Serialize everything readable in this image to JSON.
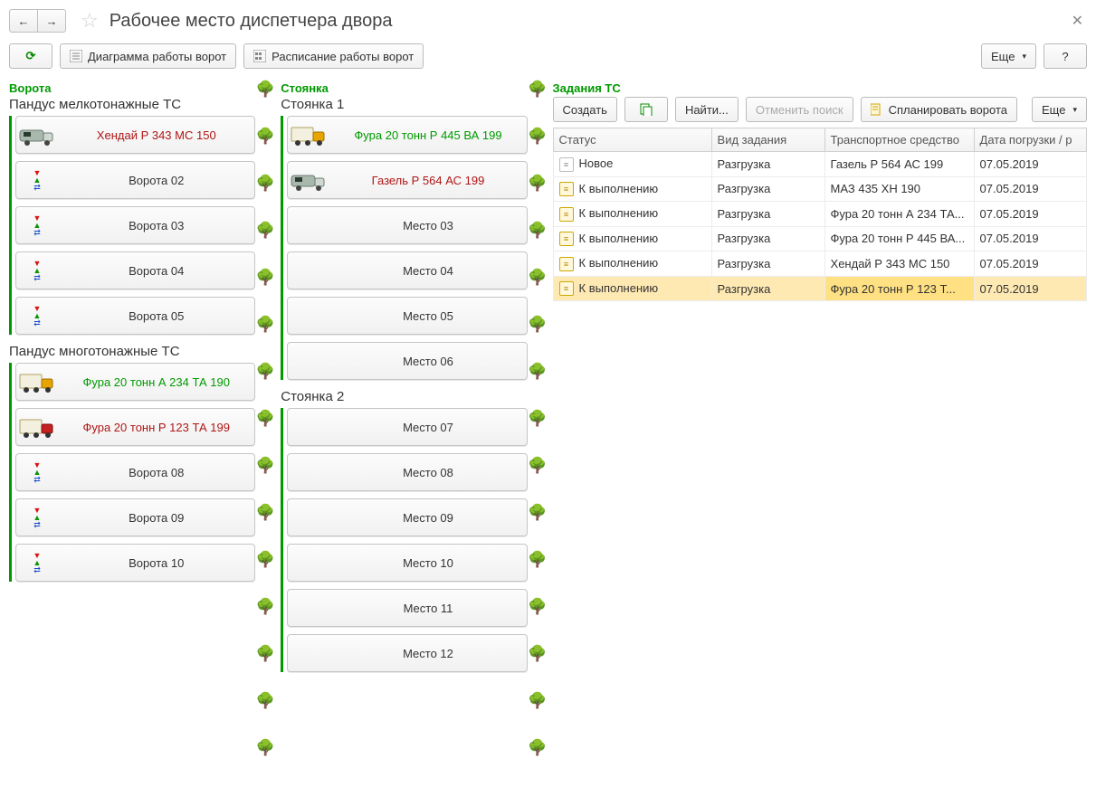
{
  "title": "Рабочее место диспетчера двора",
  "top_toolbar": {
    "refresh_tip": "⟳",
    "gate_diagram": "Диаграмма работы ворот",
    "gate_schedule": "Расписание работы ворот",
    "more": "Еще",
    "help": "?"
  },
  "gates_panel": {
    "title": "Ворота",
    "groups": [
      {
        "title": "Пандус мелкотонажные ТС",
        "slots": [
          {
            "name": "gate-01",
            "icon": "van-grey",
            "label": "Хендай Р 343 МС 150",
            "color": "red"
          },
          {
            "name": "gate-02",
            "icon": "arrows",
            "label": "Ворота 02",
            "color": ""
          },
          {
            "name": "gate-03",
            "icon": "arrows",
            "label": "Ворота 03",
            "color": ""
          },
          {
            "name": "gate-04",
            "icon": "arrows",
            "label": "Ворота 04",
            "color": ""
          },
          {
            "name": "gate-05",
            "icon": "arrows",
            "label": "Ворота 05",
            "color": ""
          }
        ]
      },
      {
        "title": "Пандус многотонажные ТС",
        "slots": [
          {
            "name": "gate-06",
            "icon": "truck-yellow",
            "label": "Фура 20 тонн А 234 ТА 190",
            "color": "green"
          },
          {
            "name": "gate-07",
            "icon": "truck-red",
            "label": "Фура 20 тонн  Р 123 ТА 199",
            "color": "red"
          },
          {
            "name": "gate-08",
            "icon": "arrows",
            "label": "Ворота 08",
            "color": ""
          },
          {
            "name": "gate-09",
            "icon": "arrows",
            "label": "Ворота 09",
            "color": ""
          },
          {
            "name": "gate-10",
            "icon": "arrows",
            "label": "Ворота 10",
            "color": ""
          }
        ]
      }
    ]
  },
  "parking_panel": {
    "title": "Стоянка",
    "groups": [
      {
        "title": "Стоянка 1",
        "slots": [
          {
            "name": "slot-01",
            "icon": "truck-yellow",
            "label": "Фура 20 тонн Р 445 ВА 199",
            "color": "green"
          },
          {
            "name": "slot-02",
            "icon": "van-grey",
            "label": "Газель Р 564 АС 199",
            "color": "red"
          },
          {
            "name": "slot-03",
            "icon": "",
            "label": "Место 03",
            "color": ""
          },
          {
            "name": "slot-04",
            "icon": "",
            "label": "Место 04",
            "color": ""
          },
          {
            "name": "slot-05",
            "icon": "",
            "label": "Место 05",
            "color": ""
          },
          {
            "name": "slot-06",
            "icon": "",
            "label": "Место 06",
            "color": ""
          }
        ]
      },
      {
        "title": "Стоянка 2",
        "slots": [
          {
            "name": "slot-07",
            "icon": "",
            "label": "Место 07",
            "color": ""
          },
          {
            "name": "slot-08",
            "icon": "",
            "label": "Место 08",
            "color": ""
          },
          {
            "name": "slot-09",
            "icon": "",
            "label": "Место 09",
            "color": ""
          },
          {
            "name": "slot-10",
            "icon": "",
            "label": "Место 10",
            "color": ""
          },
          {
            "name": "slot-11",
            "icon": "",
            "label": "Место 11",
            "color": ""
          },
          {
            "name": "slot-12",
            "icon": "",
            "label": "Место 12",
            "color": ""
          }
        ]
      }
    ]
  },
  "tasks_panel": {
    "title": "Задания ТС",
    "toolbar": {
      "create": "Создать",
      "copy_tip": "⧉",
      "find": "Найти...",
      "cancel_search": "Отменить поиск",
      "plan_gates": "Спланировать ворота",
      "more": "Еще"
    },
    "columns": [
      "Статус",
      "Вид задания",
      "Транспортное средство",
      "Дата погрузки / р"
    ],
    "rows": [
      {
        "icon": "new",
        "status": "Новое",
        "type": "Разгрузка",
        "vehicle": "Газель Р 564 АС 199",
        "date": "07.05.2019",
        "sel": false
      },
      {
        "icon": "plan",
        "status": "К выполнению",
        "type": "Разгрузка",
        "vehicle": "МАЗ 435 ХН 190",
        "date": "07.05.2019",
        "sel": false
      },
      {
        "icon": "plan",
        "status": "К выполнению",
        "type": "Разгрузка",
        "vehicle": "Фура 20 тонн А 234 ТА...",
        "date": "07.05.2019",
        "sel": false
      },
      {
        "icon": "plan",
        "status": "К выполнению",
        "type": "Разгрузка",
        "vehicle": "Фура 20 тонн Р 445 ВА...",
        "date": "07.05.2019",
        "sel": false
      },
      {
        "icon": "plan",
        "status": "К выполнению",
        "type": "Разгрузка",
        "vehicle": "Хендай Р 343 МС 150",
        "date": "07.05.2019",
        "sel": false
      },
      {
        "icon": "plan",
        "status": "К выполнению",
        "type": "Разгрузка",
        "vehicle": "Фура 20 тонн  Р 123 Т...",
        "date": "07.05.2019",
        "sel": true
      }
    ]
  },
  "tree_count_left": 15,
  "tree_count_right": 15
}
